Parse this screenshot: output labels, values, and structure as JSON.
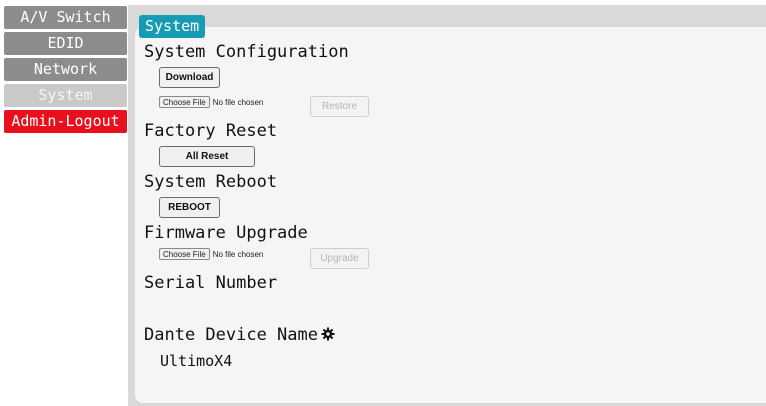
{
  "sidebar": {
    "items": [
      {
        "label": "A/V Switch"
      },
      {
        "label": "EDID"
      },
      {
        "label": "Network"
      },
      {
        "label": "System"
      },
      {
        "label": "Admin-Logout"
      }
    ]
  },
  "tab": {
    "label": "System"
  },
  "system_configuration": {
    "heading": "System Configuration",
    "download_label": "Download",
    "choose_file_label": "Choose File",
    "file_status": "No file chosen",
    "restore_label": "Restore"
  },
  "factory_reset": {
    "heading": "Factory Reset",
    "all_reset_label": "All Reset"
  },
  "system_reboot": {
    "heading": "System Reboot",
    "reboot_label": "REBOOT"
  },
  "firmware_upgrade": {
    "heading": "Firmware Upgrade",
    "choose_file_label": "Choose File",
    "file_status": "No file chosen",
    "upgrade_label": "Upgrade"
  },
  "serial_number": {
    "heading": "Serial Number"
  },
  "dante": {
    "heading": "Dante Device Name",
    "icon": "gear-icon",
    "device_name": "UltimoX4"
  },
  "colors": {
    "accent": "#179bb4",
    "logout": "#e8101c",
    "nav": "#8c8c8c",
    "nav_active": "#c9c9c9"
  }
}
